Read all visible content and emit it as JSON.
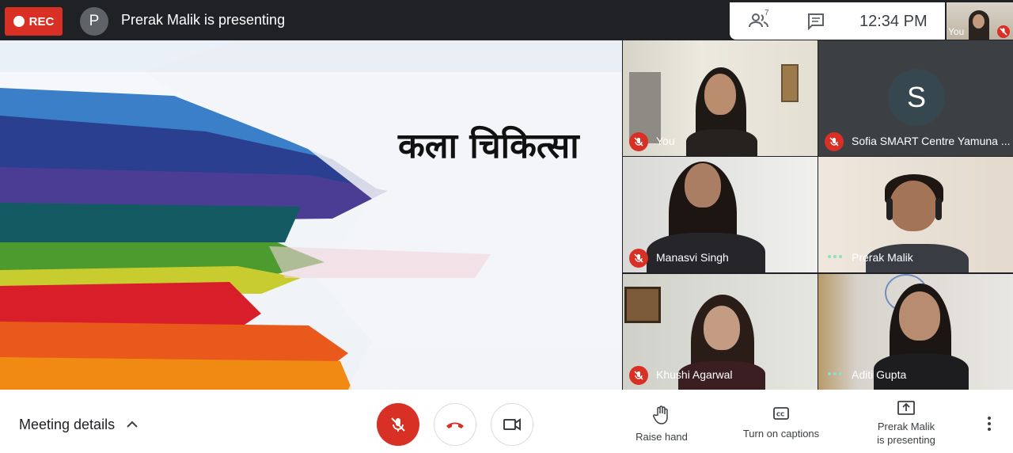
{
  "topbar": {
    "rec_label": "REC",
    "presenter_initial": "P",
    "presenter_title": "Prerak Malik is presenting",
    "people_count": "7",
    "time": "12:34  PM",
    "self_label": "You"
  },
  "slide": {
    "title": "कला चिकित्सा"
  },
  "participants": [
    {
      "name": "You",
      "status": "muted"
    },
    {
      "name": "Sofia SMART Centre Yamuna ...",
      "status": "muted",
      "initial": "S"
    },
    {
      "name": "Manasvi Singh",
      "status": "muted"
    },
    {
      "name": "Prerak Malik",
      "status": "speaking"
    },
    {
      "name": "Khushi Agarwal",
      "status": "muted"
    },
    {
      "name": "Aditi Gupta",
      "status": "speaking"
    }
  ],
  "bottombar": {
    "meeting_details": "Meeting details",
    "raise_hand": "Raise hand",
    "captions": "Turn on captions",
    "presenting_line1": "Prerak Malik",
    "presenting_line2": "is presenting"
  },
  "colors": {
    "rec": "#d93025",
    "bar": "#202124",
    "speaking": "#8ee0c2"
  }
}
